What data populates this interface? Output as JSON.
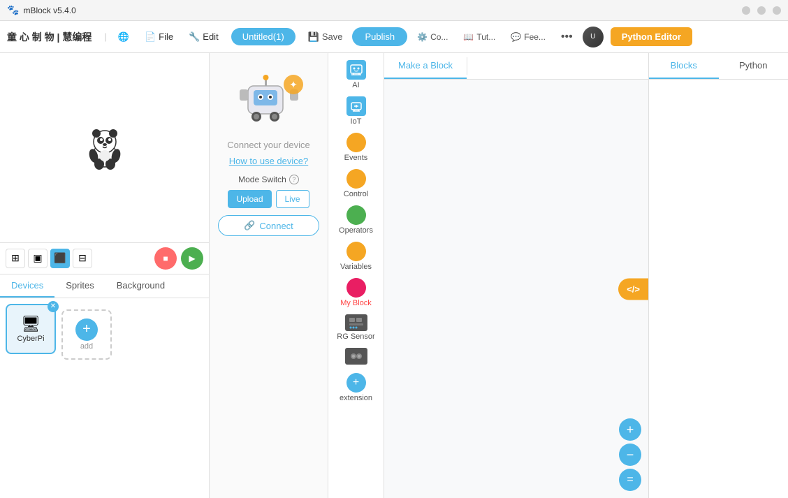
{
  "titlebar": {
    "title": "mBlock v5.4.0",
    "min_btn": "—",
    "max_btn": "□",
    "close_btn": "✕"
  },
  "menubar": {
    "brand": "童 心 制 物 | 慧编程",
    "globe_icon": "🌐",
    "file_label": "File",
    "edit_label": "Edit",
    "project_name": "Untitled(1)",
    "save_label": "Save",
    "publish_label": "Publish",
    "connect_label": "Co...",
    "tutorial_label": "Tut...",
    "feedback_label": "Fee...",
    "more_label": "•••",
    "python_editor_label": "Python Editor"
  },
  "stage": {
    "controls": [
      "⊞",
      "▣",
      "⬛",
      "⊟"
    ],
    "stop_icon": "■",
    "go_icon": "▶"
  },
  "tabs": {
    "devices_label": "Devices",
    "sprites_label": "Sprites",
    "background_label": "Background"
  },
  "device_panel": {
    "device_name": "CyberPi",
    "add_label": "add",
    "connect_text": "Connect your device",
    "how_to_label": "How to use device?",
    "mode_switch_label": "Mode Switch",
    "upload_label": "Upload",
    "live_label": "Live",
    "connect_btn_label": "Connect"
  },
  "categories": [
    {
      "id": "ai",
      "label": "AI",
      "type": "icon",
      "color": "#4db6e8"
    },
    {
      "id": "iot",
      "label": "IoT",
      "type": "icon",
      "color": "#4db6e8"
    },
    {
      "id": "events",
      "label": "Events",
      "type": "dot",
      "color": "#f5a623"
    },
    {
      "id": "control",
      "label": "Control",
      "type": "dot",
      "color": "#f5a623"
    },
    {
      "id": "operators",
      "label": "Operators",
      "type": "dot",
      "color": "#4caf50"
    },
    {
      "id": "variables",
      "label": "Variables",
      "type": "dot",
      "color": "#f5a623"
    },
    {
      "id": "my-block",
      "label": "My Block",
      "type": "dot",
      "color": "#e91e63"
    },
    {
      "id": "rgb-sensor",
      "label": "RGB Sensor",
      "type": "icon",
      "color": "#555"
    },
    {
      "id": "sensor2",
      "label": "",
      "type": "icon",
      "color": "#555"
    },
    {
      "id": "extension",
      "label": "extension",
      "type": "plus",
      "color": "#4db6e8"
    }
  ],
  "workspace": {
    "make_block_tab": "Make a Block",
    "blocks_tab": "Blocks",
    "python_tab": "Python",
    "code_float_label": "</>",
    "zoom_in_label": "+",
    "zoom_out_label": "−",
    "zoom_reset_label": "="
  }
}
